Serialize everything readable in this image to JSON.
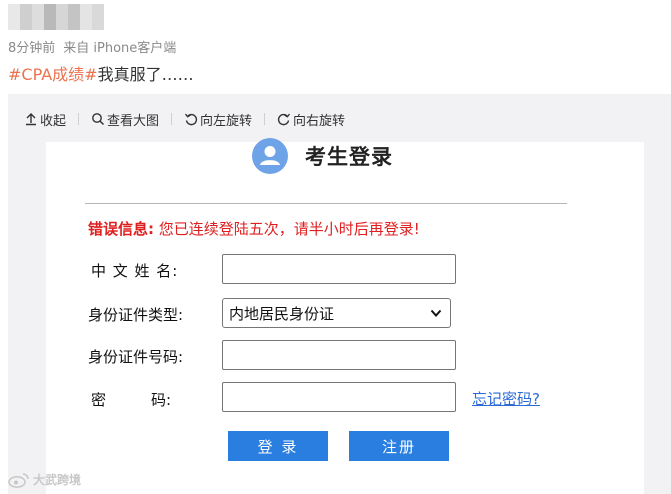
{
  "post": {
    "meta_time": "8分钟前",
    "meta_source": "来自 iPhone客户端",
    "hashtag": "#CPA成绩#",
    "text": "我真服了……"
  },
  "toolbar": {
    "collapse_label": "收起",
    "view_large_label": "查看大图",
    "rotate_left_label": "向左旋转",
    "rotate_right_label": "向右旋转"
  },
  "login": {
    "title": "考生登录",
    "error_label": "错误信息:",
    "error_message": "您已连续登陆五次，请半小时后再登录!",
    "name_label": "中 文 姓 名:",
    "id_type_label": "身份证件类型:",
    "id_type_value": "内地居民身份证",
    "id_number_label": "身份证件号码:",
    "password_label": "密　　　码:",
    "forgot_link": "忘记密码?",
    "login_button": "登 录",
    "register_button": "注册"
  },
  "watermark": "大武跨境",
  "colors": {
    "hashtag": "#eb7350",
    "error": "#e02020",
    "button": "#2a7ee0",
    "link": "#2a6ad8"
  },
  "icons": [
    "collapse-icon",
    "magnifier-icon",
    "rotate-left-icon",
    "rotate-right-icon",
    "user-avatar-icon",
    "chevron-down-icon",
    "weibo-logo-icon"
  ]
}
